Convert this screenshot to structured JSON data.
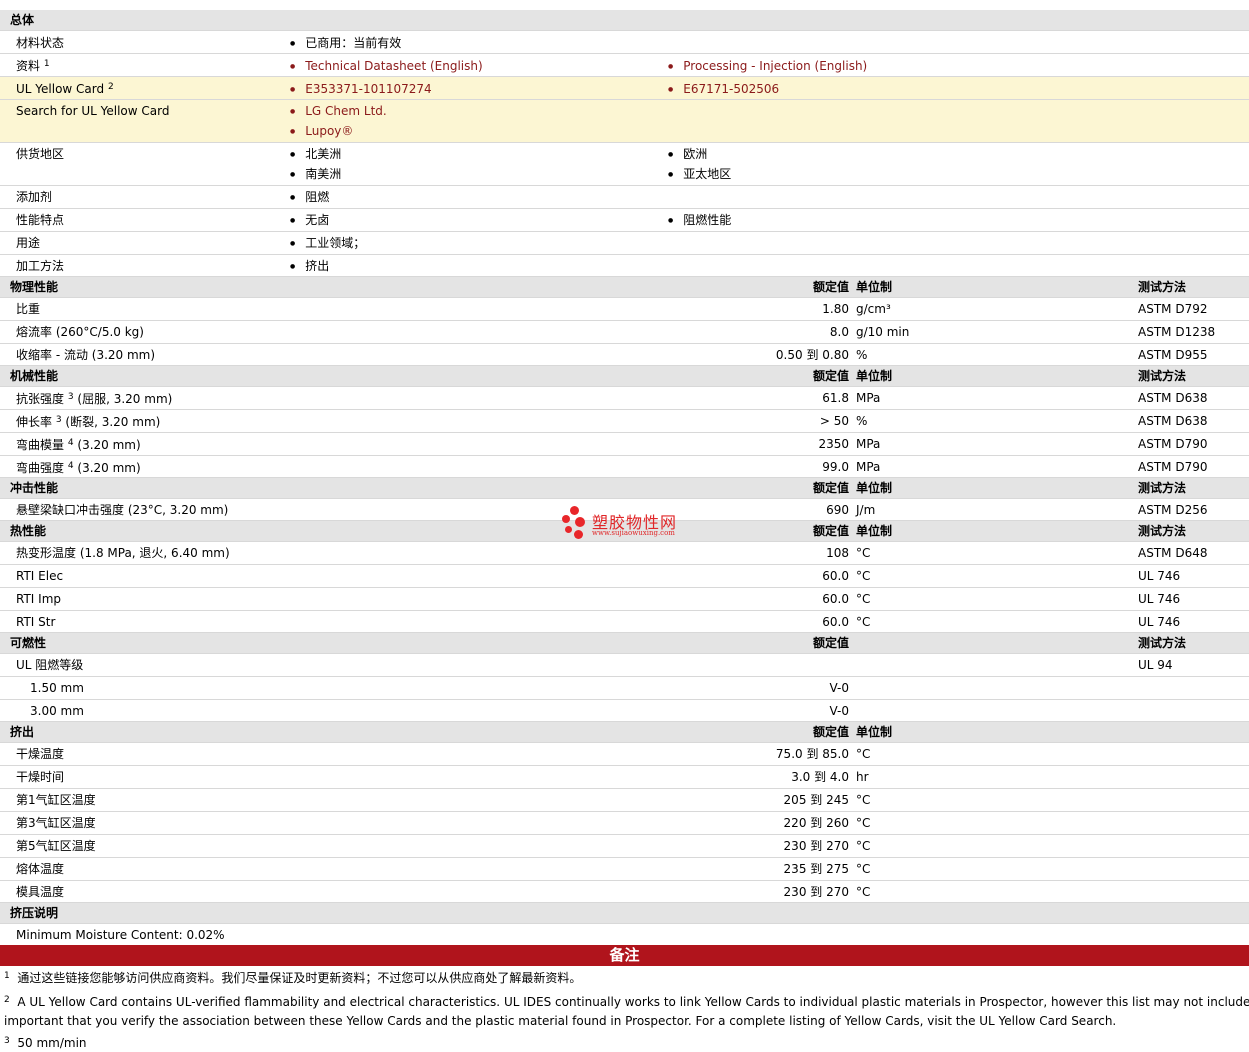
{
  "general": {
    "title": "总体",
    "material_status_label": "材料状态",
    "material_status_value": "已商用：当前有效",
    "docs_label": "资料",
    "docs_sup": "1",
    "docs_link1": "Technical Datasheet (English)",
    "docs_link2": "Processing - Injection (English)",
    "ul_label": "UL Yellow Card",
    "ul_sup": "2",
    "ul_link1": "E353371-101107274",
    "ul_link2": "E67171-502506",
    "search_label": "Search for UL Yellow Card",
    "search_link1": "LG Chem Ltd.",
    "search_link2": "Lupoy®",
    "region_label": "供货地区",
    "regions": [
      "北美洲",
      "欧洲",
      "南美洲",
      "亚太地区"
    ],
    "additive_label": "添加剂",
    "additive_value": "阻燃",
    "features_label": "性能特点",
    "features": [
      "无卤",
      "阻燃性能"
    ],
    "uses_label": "用途",
    "uses_value": "工业领域；",
    "processing_label": "加工方法",
    "processing_value": "挤出"
  },
  "headers": {
    "rated": "额定值",
    "unit": "单位制",
    "method": "测试方法"
  },
  "physical": {
    "title": "物理性能",
    "rows": [
      {
        "name": "比重",
        "value": "1.80",
        "unit": "g/cm³",
        "method": "ASTM D792"
      },
      {
        "name": "熔流率  (260°C/5.0 kg)",
        "value": "8.0",
        "unit": "g/10 min",
        "method": "ASTM D1238"
      },
      {
        "name": "收缩率  - 流动  (3.20 mm)",
        "value": "0.50  到   0.80",
        "unit": "%",
        "method": "ASTM D955"
      }
    ]
  },
  "mechanical": {
    "title": "机械性能",
    "rows": [
      {
        "name": "抗张强度",
        "sup": "3",
        "cond": "(屈服, 3.20 mm)",
        "value": "61.8",
        "unit": "MPa",
        "method": "ASTM D638"
      },
      {
        "name": "伸长率",
        "sup": "3",
        "cond": "(断裂, 3.20 mm)",
        "value": "> 50",
        "unit": "%",
        "method": "ASTM D638"
      },
      {
        "name": "弯曲模量",
        "sup": "4",
        "cond": "(3.20 mm)",
        "value": "2350",
        "unit": "MPa",
        "method": "ASTM D790"
      },
      {
        "name": "弯曲强度",
        "sup": "4",
        "cond": "(3.20 mm)",
        "value": "99.0",
        "unit": "MPa",
        "method": "ASTM D790"
      }
    ]
  },
  "impact": {
    "title": "冲击性能",
    "rows": [
      {
        "name": "悬壁梁缺口冲击强度  (23°C, 3.20 mm)",
        "value": "690",
        "unit": "J/m",
        "method": "ASTM D256"
      }
    ]
  },
  "thermal": {
    "title": "热性能",
    "rows": [
      {
        "name": "热变形温度  (1.8 MPa, 退火, 6.40 mm)",
        "value": "108",
        "unit": "°C",
        "method": "ASTM D648"
      },
      {
        "name": "RTI Elec",
        "value": "60.0",
        "unit": "°C",
        "method": "UL 746"
      },
      {
        "name": "RTI Imp",
        "value": "60.0",
        "unit": "°C",
        "method": "UL 746"
      },
      {
        "name": "RTI Str",
        "value": "60.0",
        "unit": "°C",
        "method": "UL 746"
      }
    ]
  },
  "flammability": {
    "title": "可燃性",
    "rating_label": "UL 阻燃等级",
    "rating_method": "UL 94",
    "rows": [
      {
        "name": "1.50 mm",
        "value": "V-0"
      },
      {
        "name": "3.00 mm",
        "value": "V-0"
      }
    ]
  },
  "extrusion": {
    "title": "挤出",
    "rows": [
      {
        "name": "干燥温度",
        "value": "75.0  到   85.0",
        "unit": "°C"
      },
      {
        "name": "干燥时间",
        "value": "3.0  到   4.0",
        "unit": "hr"
      },
      {
        "name": "第1气缸区温度",
        "value": "205  到   245",
        "unit": "°C"
      },
      {
        "name": "第3气缸区温度",
        "value": "220  到   260",
        "unit": "°C"
      },
      {
        "name": "第5气缸区温度",
        "value": "230  到   270",
        "unit": "°C"
      },
      {
        "name": "熔体温度",
        "value": "235  到   275",
        "unit": "°C"
      },
      {
        "name": "模具温度",
        "value": "230  到   270",
        "unit": "°C"
      }
    ]
  },
  "extrusion_notes": {
    "title": "挤压说明",
    "text": "Minimum Moisture Content: 0.02%"
  },
  "notes": {
    "title": "备注",
    "n1_sup": "1",
    "n1": "通过这些链接您能够访问供应商资料。我们尽量保证及时更新资料；不过您可以从供应商处了解最新资料。",
    "n2_sup": "2",
    "n2_line1": "A UL Yellow Card contains UL-verified flammability and electrical characteristics. UL IDES continually works to link Yellow Cards to individual plastic materials in Prospector, however this list may not include all of",
    "n2_line2": "important that you verify the association between these Yellow Cards and the plastic material found in Prospector. For a complete listing of Yellow Cards, visit the UL Yellow Card Search.",
    "n3_sup": "3",
    "n3": "50 mm/min"
  },
  "watermark": {
    "title": "塑胶物性网",
    "url": "www.sujiaowuxing.com"
  },
  "colors": {
    "link": "#8b1a1a",
    "header_bg": "#e4e4e4",
    "highlight_bg": "#fcf6d3",
    "band_bg": "#b0141c"
  }
}
